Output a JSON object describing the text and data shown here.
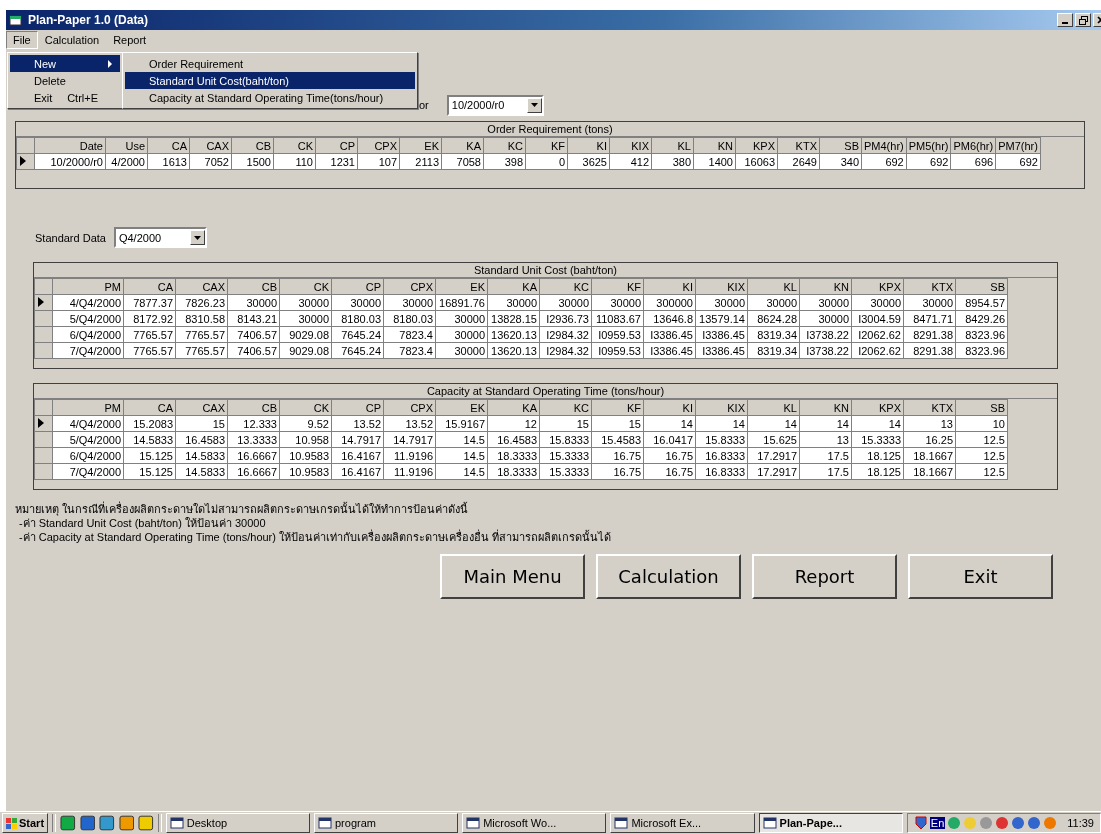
{
  "window": {
    "title": "Plan-Paper 1.0 (Data)"
  },
  "menu_bar": [
    {
      "label": "File",
      "selected": true
    },
    {
      "label": "Calculation",
      "selected": false
    },
    {
      "label": "Report",
      "selected": false
    }
  ],
  "file_menu": [
    {
      "label": "New",
      "submenu": true,
      "selected": true
    },
    {
      "label": "Delete",
      "submenu": false,
      "selected": false
    },
    {
      "label": "Exit",
      "shortcut": "Ctrl+E",
      "submenu": false,
      "selected": false
    }
  ],
  "new_submenu": [
    {
      "label": "Order Requirement",
      "selected": false
    },
    {
      "label": "Standard Unit Cost(baht/ton)",
      "selected": true
    },
    {
      "label": "Capacity at Standard Operating Time(tons/hour)",
      "selected": false
    }
  ],
  "order_filter": {
    "label": "or",
    "value": "10/2000/r0"
  },
  "order_table": {
    "caption": "Order Requirement (tons)",
    "columns": [
      "Date",
      "Use",
      "CA",
      "CAX",
      "CB",
      "CK",
      "CP",
      "CPX",
      "EK",
      "KA",
      "KC",
      "KF",
      "KI",
      "KIX",
      "KL",
      "KN",
      "KPX",
      "KTX",
      "SB",
      "PM4(hr)",
      "PM5(hr)",
      "PM6(hr)",
      "PM7(hr)"
    ],
    "rows": [
      {
        "selected": true,
        "cells": [
          "10/2000/r0",
          "4/2000",
          "1613",
          "7052",
          "1500",
          "110",
          "1231",
          "107",
          "2113",
          "7058",
          "398",
          "0",
          "3625",
          "412",
          "380",
          "1400",
          "16063",
          "2649",
          "340",
          "692",
          "692",
          "696",
          "692"
        ]
      }
    ]
  },
  "standard_data": {
    "label": "Standard Data",
    "value": "Q4/2000"
  },
  "cost_table": {
    "caption": "Standard Unit Cost (baht/ton)",
    "columns": [
      "PM",
      "CA",
      "CAX",
      "CB",
      "CK",
      "CP",
      "CPX",
      "EK",
      "KA",
      "KC",
      "KF",
      "KI",
      "KIX",
      "KL",
      "KN",
      "KPX",
      "KTX",
      "SB"
    ],
    "rows": [
      {
        "selected": true,
        "cells": [
          "4/Q4/2000",
          "7877.37",
          "7826.23",
          "30000",
          "30000",
          "30000",
          "30000",
          "16891.76",
          "30000",
          "30000",
          "30000",
          "300000",
          "30000",
          "30000",
          "30000",
          "30000",
          "30000",
          "8954.57"
        ]
      },
      {
        "selected": false,
        "cells": [
          "5/Q4/2000",
          "8172.92",
          "8310.58",
          "8143.21",
          "30000",
          "8180.03",
          "8180.03",
          "30000",
          "13828.15",
          "I2936.73",
          "11083.67",
          "13646.8",
          "13579.14",
          "8624.28",
          "30000",
          "I3004.59",
          "8471.71",
          "8429.26"
        ]
      },
      {
        "selected": false,
        "cells": [
          "6/Q4/2000",
          "7765.57",
          "7765.57",
          "7406.57",
          "9029.08",
          "7645.24",
          "7823.4",
          "30000",
          "13620.13",
          "I2984.32",
          "I0959.53",
          "I3386.45",
          "I3386.45",
          "8319.34",
          "I3738.22",
          "I2062.62",
          "8291.38",
          "8323.96"
        ]
      },
      {
        "selected": false,
        "cells": [
          "7/Q4/2000",
          "7765.57",
          "7765.57",
          "7406.57",
          "9029.08",
          "7645.24",
          "7823.4",
          "30000",
          "13620.13",
          "I2984.32",
          "I0959.53",
          "I3386.45",
          "I3386.45",
          "8319.34",
          "I3738.22",
          "I2062.62",
          "8291.38",
          "8323.96"
        ]
      }
    ]
  },
  "capacity_table": {
    "caption": "Capacity at Standard Operating Time (tons/hour)",
    "columns": [
      "PM",
      "CA",
      "CAX",
      "CB",
      "CK",
      "CP",
      "CPX",
      "EK",
      "KA",
      "KC",
      "KF",
      "KI",
      "KIX",
      "KL",
      "KN",
      "KPX",
      "KTX",
      "SB"
    ],
    "rows": [
      {
        "selected": true,
        "cells": [
          "4/Q4/2000",
          "15.2083",
          "15",
          "12.333",
          "9.52",
          "13.52",
          "13.52",
          "15.9167",
          "12",
          "15",
          "15",
          "14",
          "14",
          "14",
          "14",
          "14",
          "13",
          "10"
        ]
      },
      {
        "selected": false,
        "cells": [
          "5/Q4/2000",
          "14.5833",
          "16.4583",
          "13.3333",
          "10.958",
          "14.7917",
          "14.7917",
          "14.5",
          "16.4583",
          "15.8333",
          "15.4583",
          "16.0417",
          "15.8333",
          "15.625",
          "13",
          "15.3333",
          "16.25",
          "12.5"
        ]
      },
      {
        "selected": false,
        "cells": [
          "6/Q4/2000",
          "15.125",
          "14.5833",
          "16.6667",
          "10.9583",
          "16.4167",
          "11.9196",
          "14.5",
          "18.3333",
          "15.3333",
          "16.75",
          "16.75",
          "16.8333",
          "17.2917",
          "17.5",
          "18.125",
          "18.1667",
          "12.5"
        ]
      },
      {
        "selected": false,
        "cells": [
          "7/Q4/2000",
          "15.125",
          "14.5833",
          "16.6667",
          "10.9583",
          "16.4167",
          "11.9196",
          "14.5",
          "18.3333",
          "15.3333",
          "16.75",
          "16.75",
          "16.8333",
          "17.2917",
          "17.5",
          "18.125",
          "18.1667",
          "12.5"
        ]
      }
    ]
  },
  "notes": [
    "หมายเหตุ ในกรณีที่เครื่องผลิตกระดาษใดไม่สามารถผลิตกระดาษเกรดนั้นได้ให้ทำการป้อนค่าดังนี้",
    "-ค่า Standard Unit Cost (baht/ton) ให้ป้อนค่า 30000",
    "-ค่า Capacity at Standard Operating Time (tons/hour) ให้ป้อนค่าเท่ากับเครื่องผลิตกระดาษเครื่องอื่น ที่สามารถผลิตเกรดนั้นได้"
  ],
  "buttons": [
    "Main Menu",
    "Calculation",
    "Report",
    "Exit"
  ],
  "taskbar": {
    "start": "Start",
    "tasks": [
      {
        "label": "Desktop",
        "selected": false
      },
      {
        "label": "program",
        "selected": false
      },
      {
        "label": "Microsoft Wo...",
        "selected": false
      },
      {
        "label": "Microsoft Ex...",
        "selected": false
      },
      {
        "label": "Plan-Pape...",
        "selected": true
      }
    ],
    "language": "En",
    "time": "11:39"
  }
}
